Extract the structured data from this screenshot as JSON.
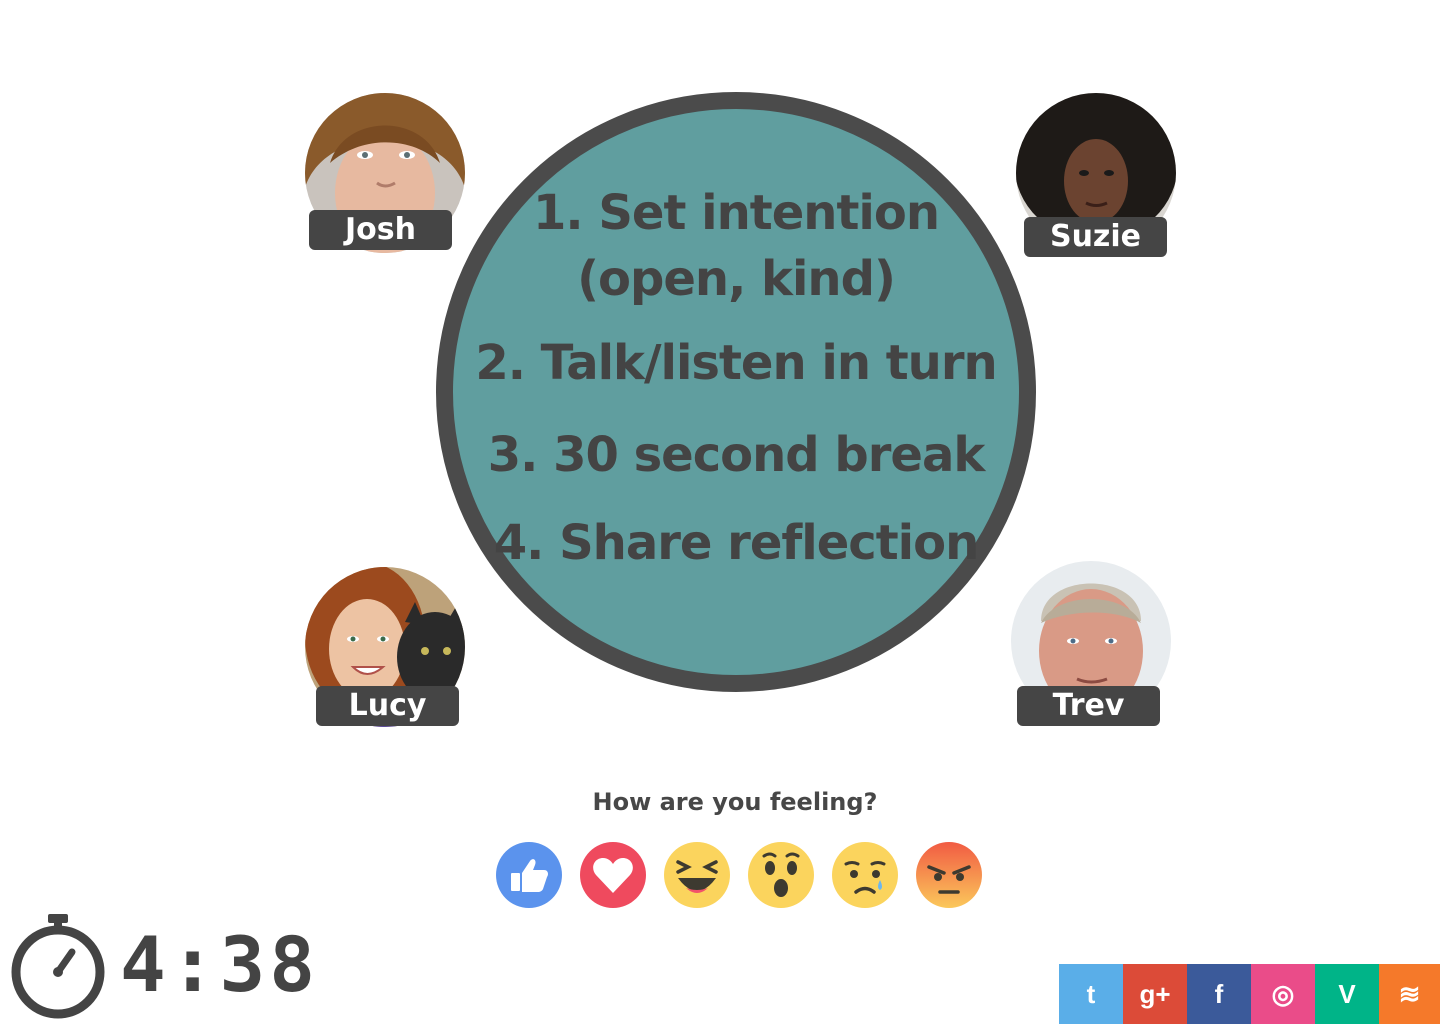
{
  "steps": [
    "1. Set  intention",
    "(open, kind)",
    "2. Talk/listen in turn",
    "3. 30 second break",
    "4. Share reflection"
  ],
  "participants": {
    "josh": {
      "name": "Josh"
    },
    "suzie": {
      "name": "Suzie"
    },
    "lucy": {
      "name": "Lucy"
    },
    "trev": {
      "name": "Trev"
    }
  },
  "feedback": {
    "prompt": "How are you feeling?",
    "reactions": [
      "like-icon",
      "love-icon",
      "laugh-icon",
      "wow-icon",
      "sad-icon",
      "angry-icon"
    ]
  },
  "timer": {
    "value": "4:38",
    "icon": "stopwatch-icon"
  },
  "social": {
    "twitter": {
      "glyph": "t",
      "color": "#5aaee8"
    },
    "gplus": {
      "glyph": "g+",
      "color": "#dc4b38"
    },
    "facebook": {
      "glyph": "f",
      "color": "#3b5a9a"
    },
    "dribbble": {
      "glyph": "◎",
      "color": "#ea4c89"
    },
    "vine": {
      "glyph": "V",
      "color": "#00b488"
    },
    "rss": {
      "glyph": "≋",
      "color": "#f5792a"
    }
  },
  "colors": {
    "table_fill": "#609e9f",
    "table_border": "#4b4b4b",
    "tag_bg": "#454545",
    "text": "#474747"
  }
}
